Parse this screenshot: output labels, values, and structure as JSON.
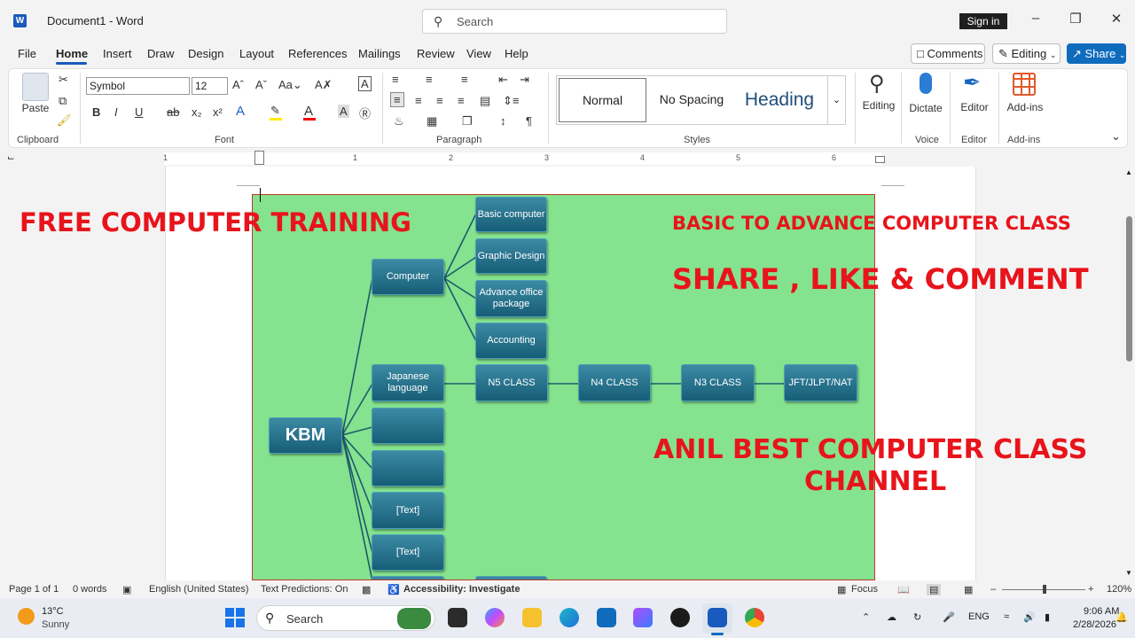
{
  "titlebar": {
    "doc_title": "Document1 - Word",
    "search_placeholder": "Search",
    "sign_in": "Sign in"
  },
  "menu": {
    "tabs": [
      "File",
      "Home",
      "Insert",
      "Draw",
      "Design",
      "Layout",
      "References",
      "Mailings",
      "Review",
      "View",
      "Help"
    ],
    "comments": "Comments",
    "editing": "Editing",
    "share": "Share"
  },
  "ribbon": {
    "paste": "Paste",
    "font_name": "Symbol",
    "font_size": "12",
    "styles": [
      "Normal",
      "No Spacing",
      "Heading"
    ],
    "editing": "Editing",
    "dictate": "Dictate",
    "editor": "Editor",
    "addins": "Add-ins",
    "groups": [
      "Clipboard",
      "Font",
      "Paragraph",
      "Styles",
      "Voice",
      "Editor",
      "Add-ins"
    ]
  },
  "ruler": {
    "numbers": [
      "1",
      "1",
      "2",
      "3",
      "4",
      "5",
      "6"
    ]
  },
  "diagram": {
    "root": "KBM",
    "computer": "Computer",
    "computer_children": [
      "Basic computer",
      "Graphic Design",
      "Advance office package",
      "Accounting"
    ],
    "japanese": "Japanese language",
    "japanese_chain": [
      "N5 CLASS",
      "N4 CLASS",
      "N3 CLASS",
      "JFT/JLPT/NAT"
    ],
    "text_nodes": [
      "[Text]",
      "[Text]"
    ]
  },
  "overlay": {
    "free_training": "FREE COMPUTER TRAINING",
    "basic_advance": "BASIC TO ADVANCE COMPUTER CLASS",
    "share_like": "SHARE , LIKE & COMMENT",
    "channel_line1": "ANIL BEST COMPUTER CLASS",
    "channel_line2": "CHANNEL"
  },
  "statusbar": {
    "page": "Page 1 of 1",
    "words": "0 words",
    "language": "English (United States)",
    "text_predictions": "Text Predictions: On",
    "accessibility": "Accessibility: Investigate",
    "focus": "Focus",
    "zoom": "120%"
  },
  "taskbar": {
    "temp": "13°C",
    "weather": "Sunny",
    "search": "Search",
    "lang": "ENG",
    "time": "9:06 AM",
    "date": "2/28/2026"
  },
  "colors": {
    "accent": "#185abd",
    "canvas_bg": "#85e28e",
    "node": "#1e6a84",
    "overlay_red": "#e8141b"
  }
}
